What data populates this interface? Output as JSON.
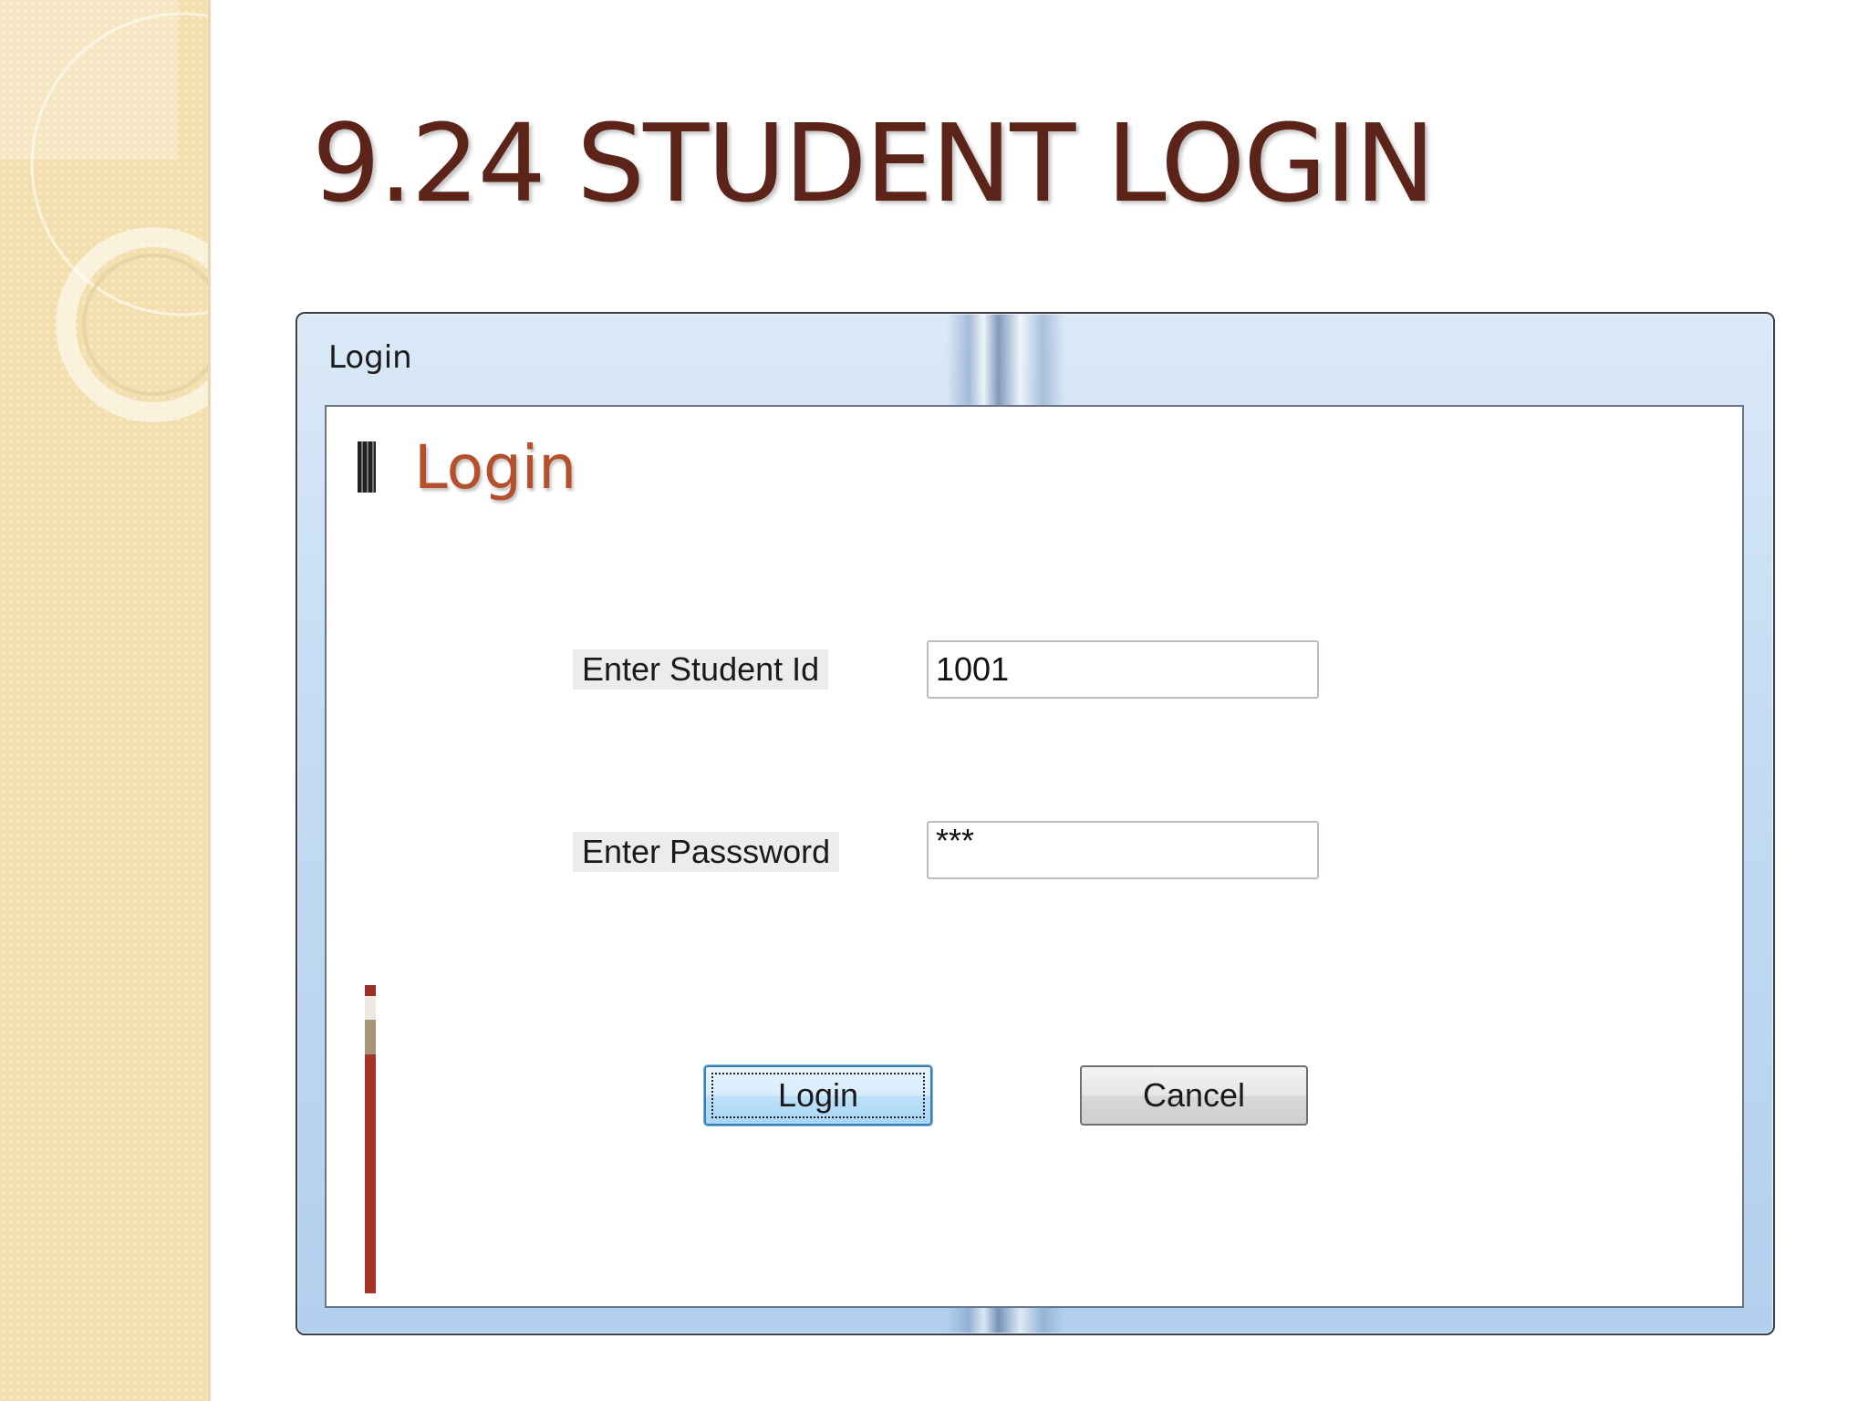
{
  "slide": {
    "title": "9.24 STUDENT LOGIN"
  },
  "window": {
    "title": "Login"
  },
  "form": {
    "header": "Login",
    "student_id_label": "Enter Student Id",
    "student_id_value": "1001",
    "password_label": "Enter Passsword",
    "password_value": "***"
  },
  "buttons": {
    "login": "Login",
    "cancel": "Cancel"
  },
  "progress": {
    "value_fraction": 0.78
  },
  "colors": {
    "title": "#5c2418",
    "header": "#b4502c",
    "accent_bar": "#a3342a",
    "side_strip": "#f3dfae"
  }
}
